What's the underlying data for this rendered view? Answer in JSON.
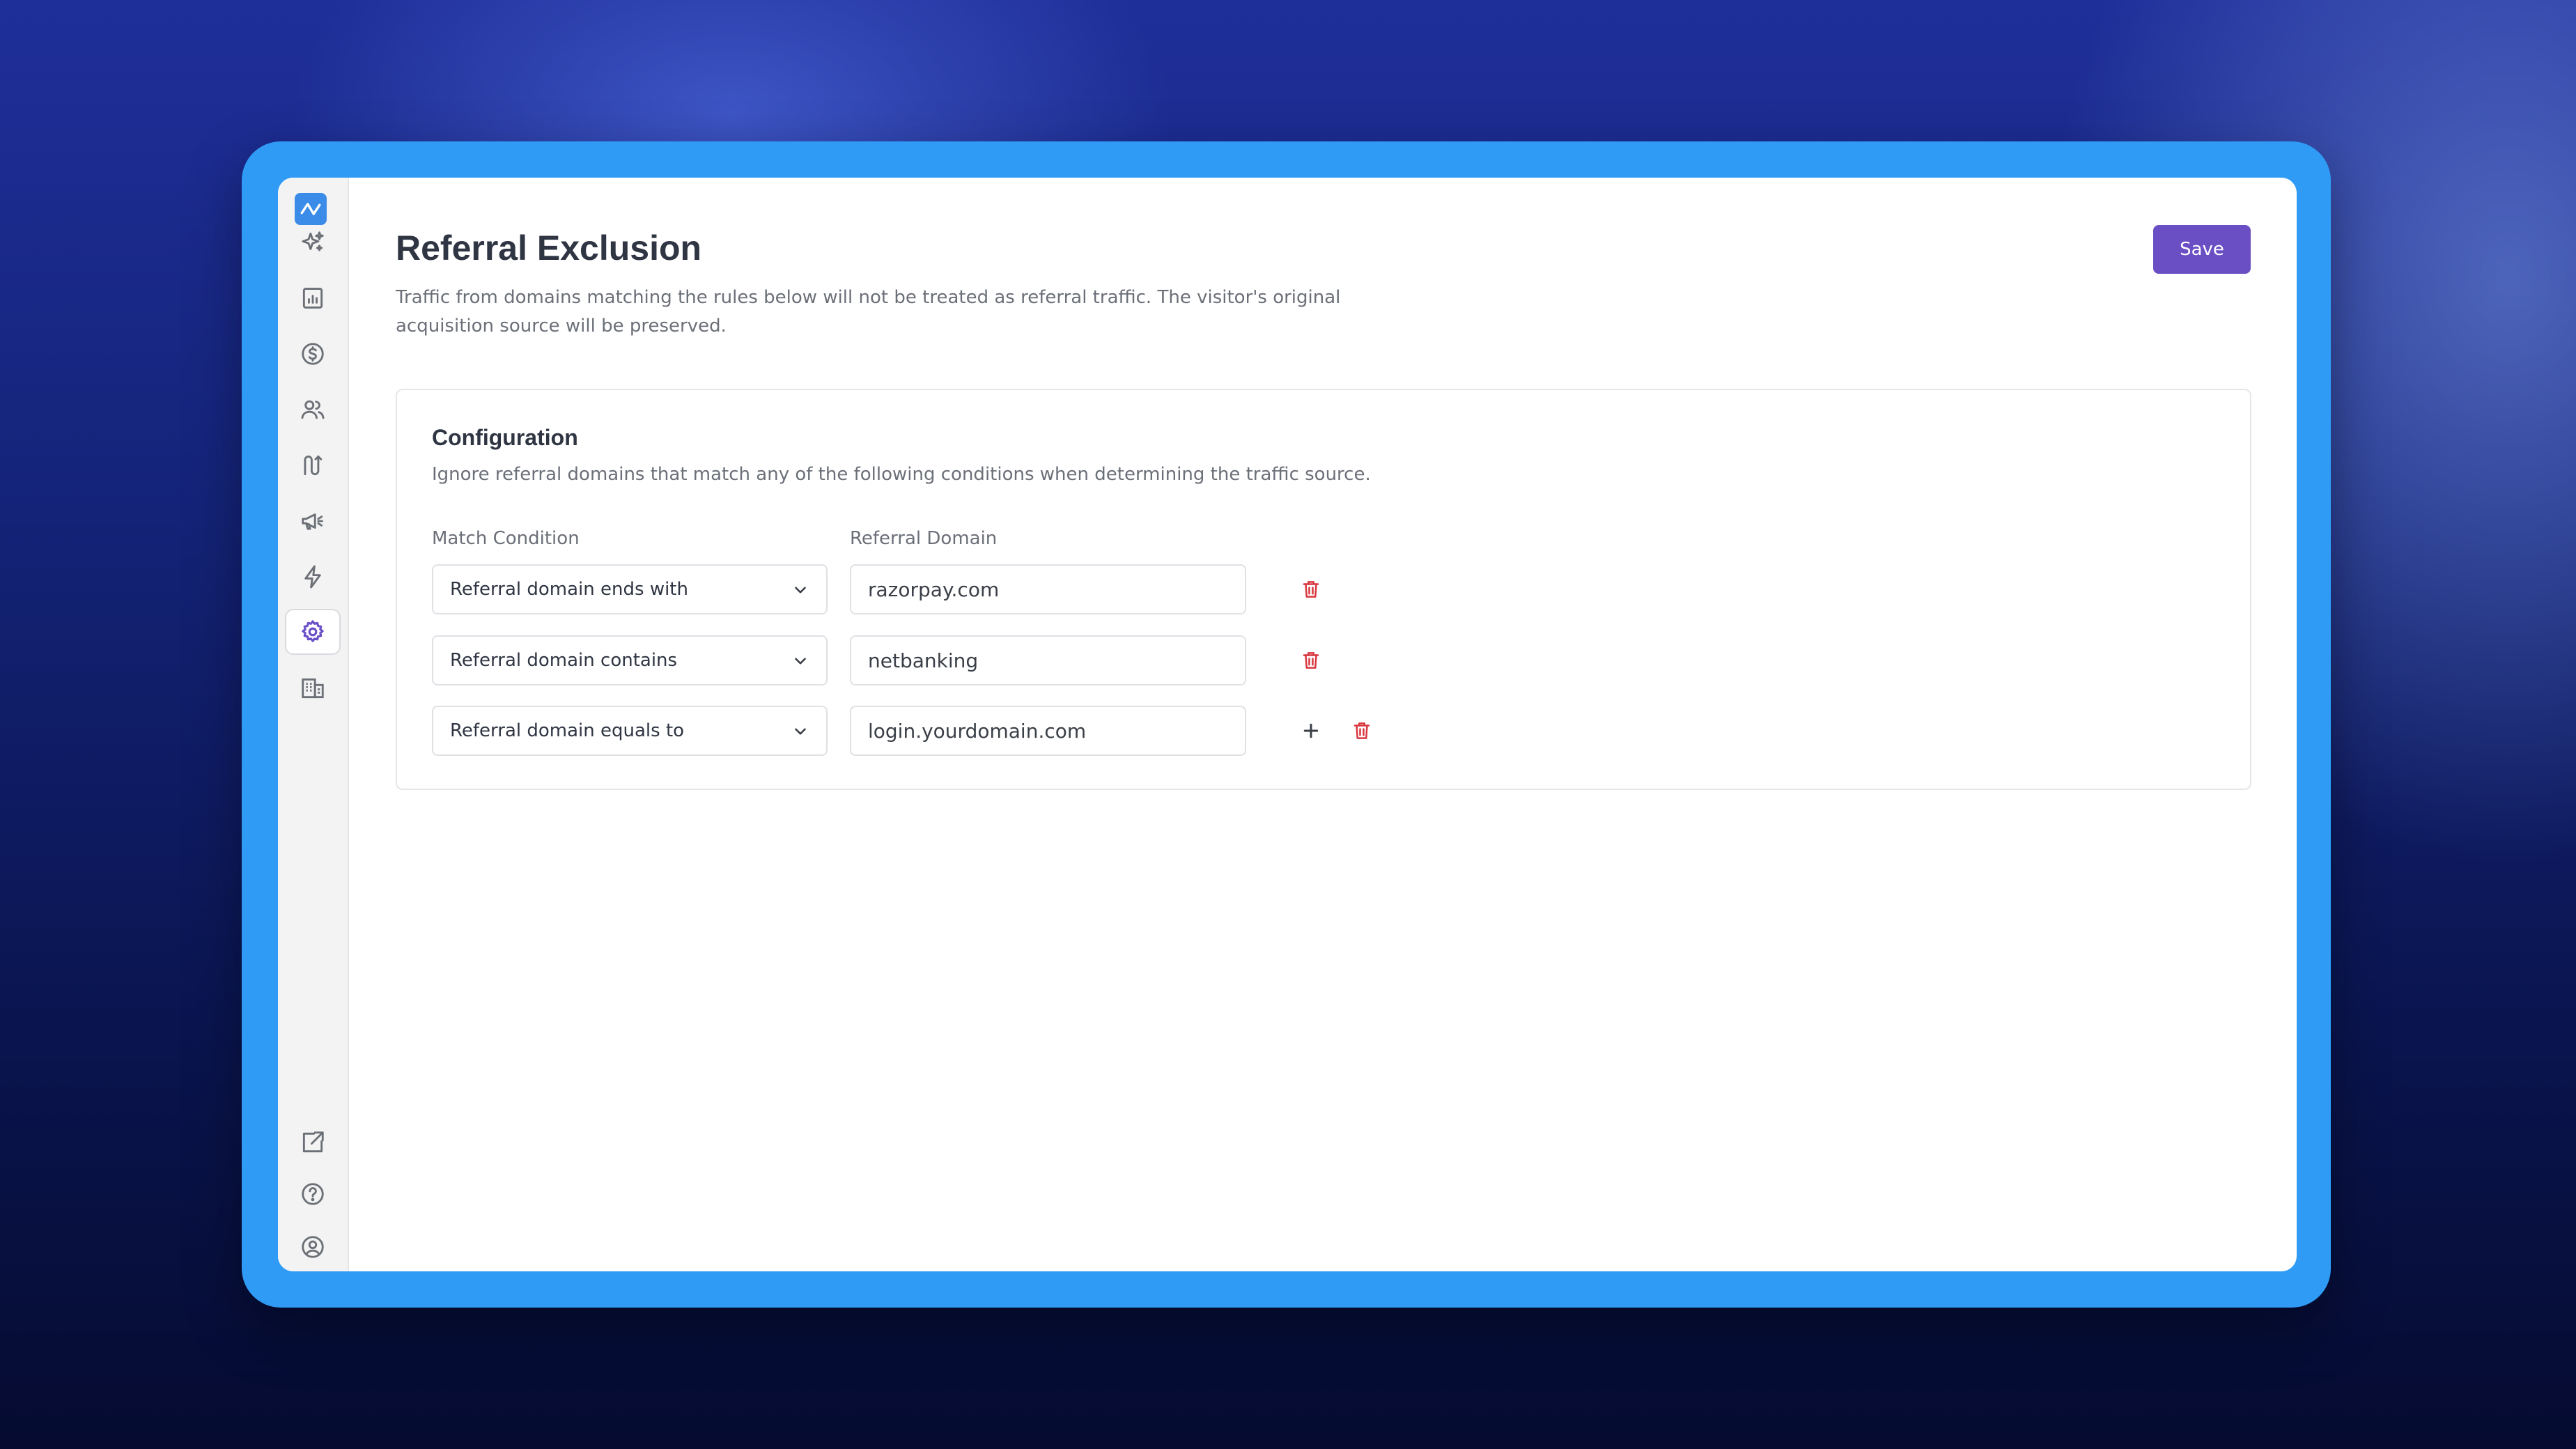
{
  "page": {
    "title": "Referral Exclusion",
    "description": "Traffic from domains matching the rules below will not be treated as referral traffic. The visitor's original acquisition source will be preserved.",
    "save_label": "Save"
  },
  "sidebar": {
    "items": [
      {
        "name": "ai-sparkle",
        "icon": "sparkles-icon"
      },
      {
        "name": "reports",
        "icon": "chart-report-icon"
      },
      {
        "name": "revenue",
        "icon": "dollar-icon"
      },
      {
        "name": "users",
        "icon": "users-icon"
      },
      {
        "name": "journeys",
        "icon": "route-icon"
      },
      {
        "name": "campaigns",
        "icon": "megaphone-icon"
      },
      {
        "name": "automations",
        "icon": "lightning-icon"
      },
      {
        "name": "settings",
        "icon": "gear-icon",
        "active": true
      },
      {
        "name": "organizations",
        "icon": "building-icon"
      }
    ],
    "bottom_items": [
      {
        "name": "external-link",
        "icon": "external-link-icon"
      },
      {
        "name": "help",
        "icon": "help-icon"
      },
      {
        "name": "account",
        "icon": "user-circle-icon"
      }
    ]
  },
  "config": {
    "title": "Configuration",
    "description": "Ignore referral domains that match any of the following conditions when determining the traffic source.",
    "col_condition": "Match Condition",
    "col_domain": "Referral Domain",
    "rows": [
      {
        "condition": "Referral domain ends with",
        "domain": "razorpay.com"
      },
      {
        "condition": "Referral domain contains",
        "domain": "netbanking"
      },
      {
        "condition": "Referral domain equals to",
        "domain": "login.yourdomain.com"
      }
    ]
  },
  "colors": {
    "accent": "#6a4fc4",
    "frame": "#2f9bf5",
    "danger": "#d9363e"
  }
}
